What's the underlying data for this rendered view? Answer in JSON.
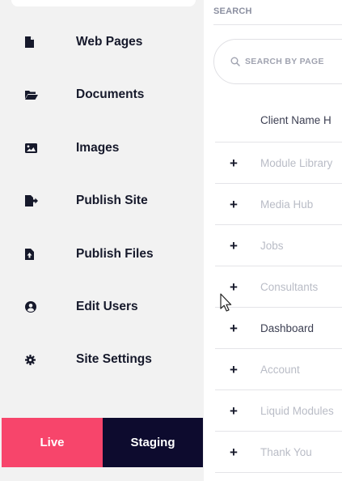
{
  "sidebar": {
    "items": [
      {
        "label": "Web Pages",
        "icon": "file-icon"
      },
      {
        "label": "Documents",
        "icon": "folder-open-icon"
      },
      {
        "label": "Images",
        "icon": "image-icon"
      },
      {
        "label": "Publish Site",
        "icon": "file-export-icon"
      },
      {
        "label": "Publish Files",
        "icon": "file-upload-icon"
      },
      {
        "label": "Edit Users",
        "icon": "user-circle-icon"
      },
      {
        "label": "Site Settings",
        "icon": "cog-icon"
      }
    ],
    "env": {
      "live": "Live",
      "staging": "Staging"
    }
  },
  "main": {
    "search_label": "SEARCH",
    "search_placeholder": "SEARCH BY PAGE",
    "column_header": "Client Name H",
    "rows": [
      {
        "name": "Module Library"
      },
      {
        "name": "Media Hub"
      },
      {
        "name": "Jobs"
      },
      {
        "name": "Consultants"
      },
      {
        "name": "Dashboard"
      },
      {
        "name": "Account"
      },
      {
        "name": "Liquid Modules"
      },
      {
        "name": "Thank You"
      }
    ],
    "row_action": "+"
  },
  "colors": {
    "live": "#f7456b",
    "staging": "#0d0b2e",
    "sidebar_bg": "#f2f2f2",
    "text_dark": "#16192b",
    "text_muted": "#b9bcc6"
  }
}
